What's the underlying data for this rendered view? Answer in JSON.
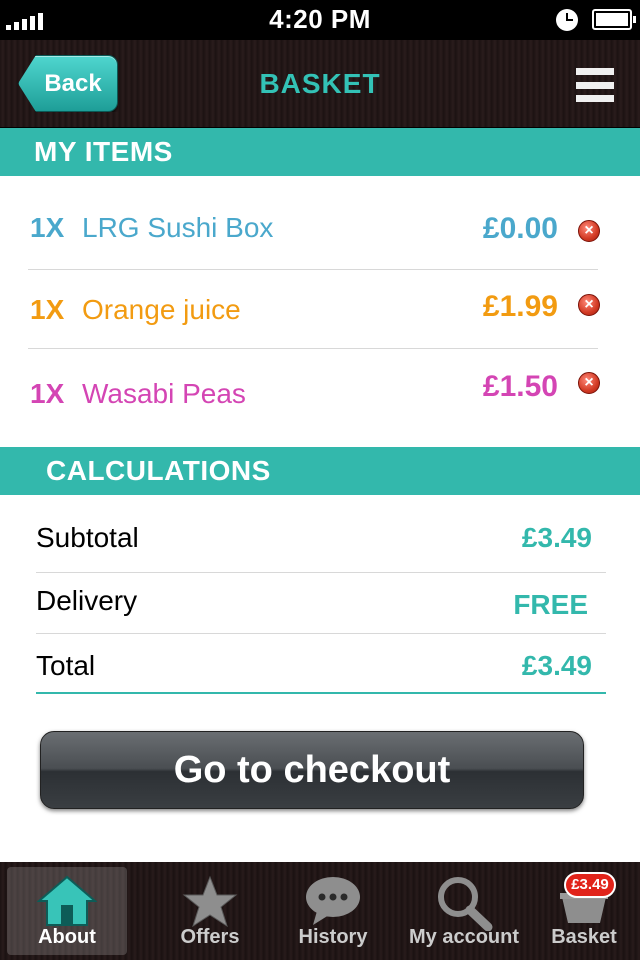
{
  "status_bar": {
    "time": "4:20 PM",
    "signal_bars": 5
  },
  "nav": {
    "back_label": "Back",
    "title": "BASKET",
    "menu_icon": "menu-icon"
  },
  "items_section": {
    "title": "MY ITEMS"
  },
  "items": [
    {
      "qty": "1X",
      "name": "LRG Sushi Box",
      "price": "£0.00",
      "color": "#4aa8cc"
    },
    {
      "qty": "1X",
      "name": "Orange juice",
      "price": "£1.99",
      "color": "#f29b11"
    },
    {
      "qty": "1X",
      "name": "Wasabi Peas",
      "price": "£1.50",
      "color": "#d445b4"
    }
  ],
  "calc_section": {
    "title": "CALCULATIONS"
  },
  "calculations": [
    {
      "label": "Subtotal",
      "value": "£3.49"
    },
    {
      "label": "Delivery",
      "value": "FREE"
    },
    {
      "label": "Total",
      "value": "£3.49"
    }
  ],
  "checkout": {
    "label": "Go to checkout"
  },
  "tabbar": {
    "tabs": [
      {
        "label": "About",
        "icon": "home-icon",
        "active": true
      },
      {
        "label": "Offers",
        "icon": "star-icon",
        "active": false
      },
      {
        "label": "History",
        "icon": "speech-bubble-icon",
        "active": false
      },
      {
        "label": "My account",
        "icon": "search-icon",
        "active": false
      },
      {
        "label": "Basket",
        "icon": "basket-icon",
        "active": false
      }
    ],
    "basket_badge": "£3.49"
  },
  "colors": {
    "accent": "#33b8ac",
    "remove": "#d23a24",
    "badge": "#e1231a"
  }
}
